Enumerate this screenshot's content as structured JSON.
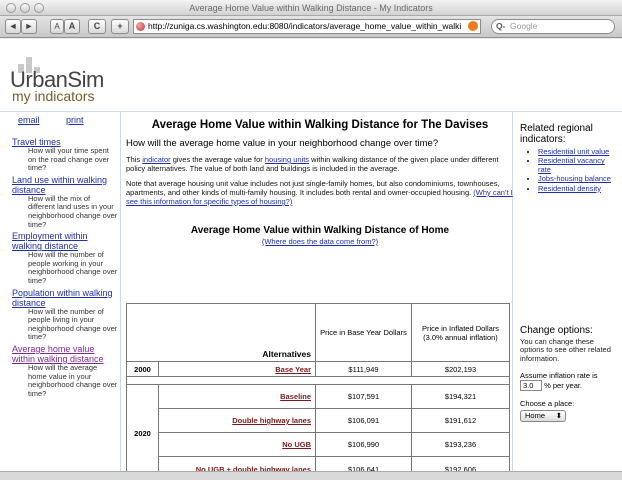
{
  "window": {
    "title": "Average Home Value within Walking Distance - My Indicators"
  },
  "toolbar": {
    "back": "◄",
    "forward": "►",
    "text_small": "A",
    "text_large": "A",
    "reload": "C",
    "add": "+",
    "url": "http://zuniga.cs.washington.edu:8080/indicators/average_home_value_within_walki",
    "search_placeholder": "Google",
    "search_label": "Q-"
  },
  "logo": {
    "name": "UrbanSim",
    "sub": "my indicators"
  },
  "topicons": {
    "email": "email",
    "print": "print"
  },
  "leftnav": [
    {
      "title": "Travel times",
      "desc": "How will your time spent on the road change over time?"
    },
    {
      "title": "Land use within walking distance",
      "desc": "How will the mix of different land uses in your neighborhood change over time?"
    },
    {
      "title": "Employment within walking distance",
      "desc": "How will the number of people working in your neighborhood change over time?"
    },
    {
      "title": "Population within walking distance",
      "desc": "How will the number of people living in your neighborhood change over time?"
    },
    {
      "title": "Average home value within walking distance",
      "desc": "How will the average home value in your neighborhood change over time?"
    }
  ],
  "main": {
    "title": "Average Home Value within Walking Distance for The Davises",
    "question": "How will the average home value in your neighborhood change over time?",
    "para1_a": "This ",
    "para1_link1": "indicator",
    "para1_b": " gives the average value for ",
    "para1_link2": "housing units",
    "para1_c": " within walking distance of the given place under different policy alternatives. The value of both land and buildings is included in the average.",
    "para2": "Note that average housing unit value includes not just single-family homes, but also condominiums, townhouses, apartments, and other kinds of multi-family housing. It includes both rental and owner-occupied housing. ",
    "para2_link": "(Why can't I see this information for specific types of housing?)",
    "table_title": "Average Home Value within Walking Distance of Home",
    "source_link": "(Where does the data come from?)"
  },
  "table": {
    "col_alternatives": "Alternatives",
    "col_base": "Price in Base Year Dollars",
    "col_inflated": "Price in Inflated Dollars (3.0% annual inflation)",
    "rows": [
      {
        "year": "2000",
        "label": "Base Year",
        "base": "$111,949",
        "inflated": "$202,193"
      },
      {
        "year": "2020",
        "label": "Baseline",
        "base": "$107,591",
        "inflated": "$194,321"
      },
      {
        "year": "",
        "label": "Double highway lanes",
        "base": "$106,091",
        "inflated": "$191,612"
      },
      {
        "year": "",
        "label": "No UGB",
        "base": "$106,990",
        "inflated": "$193,236"
      },
      {
        "year": "",
        "label": "No UGB + double highway lanes",
        "base": "$106,641",
        "inflated": "$192,606"
      }
    ]
  },
  "right": {
    "related_title": "Related regional indicators:",
    "related": [
      "Residential unit value",
      "Residential vacancy rate",
      "Jobs-housing balance",
      "Residential density"
    ],
    "change_title": "Change options:",
    "change_text": "You can change these options to see other related information.",
    "inflation_label": "Assume inflation rate is",
    "inflation_value": "3.0",
    "inflation_suffix": "% per year.",
    "place_label": "Choose a place:",
    "place_value": "Home"
  }
}
